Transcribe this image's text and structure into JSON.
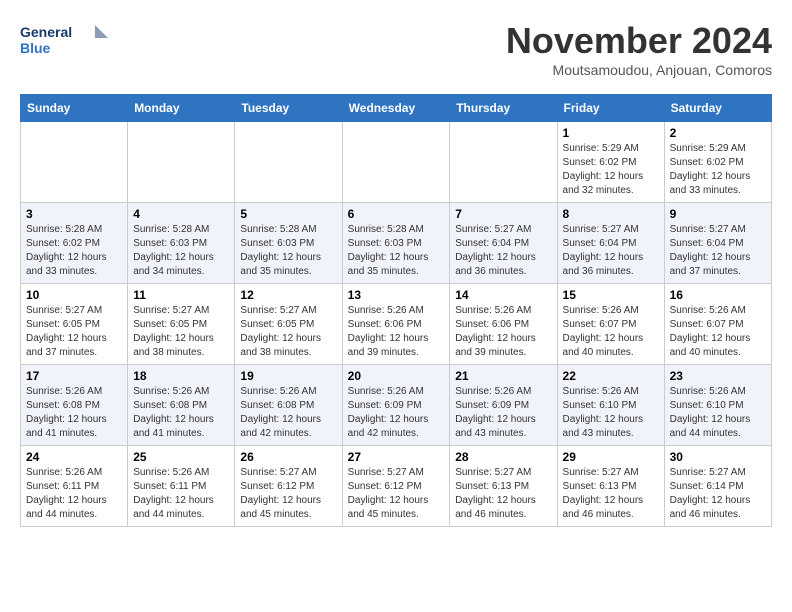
{
  "logo": {
    "line1": "General",
    "line2": "Blue"
  },
  "header": {
    "month_year": "November 2024",
    "location": "Moutsamoudou, Anjouan, Comoros"
  },
  "weekdays": [
    "Sunday",
    "Monday",
    "Tuesday",
    "Wednesday",
    "Thursday",
    "Friday",
    "Saturday"
  ],
  "weeks": [
    [
      {
        "day": "",
        "info": ""
      },
      {
        "day": "",
        "info": ""
      },
      {
        "day": "",
        "info": ""
      },
      {
        "day": "",
        "info": ""
      },
      {
        "day": "",
        "info": ""
      },
      {
        "day": "1",
        "info": "Sunrise: 5:29 AM\nSunset: 6:02 PM\nDaylight: 12 hours\nand 32 minutes."
      },
      {
        "day": "2",
        "info": "Sunrise: 5:29 AM\nSunset: 6:02 PM\nDaylight: 12 hours\nand 33 minutes."
      }
    ],
    [
      {
        "day": "3",
        "info": "Sunrise: 5:28 AM\nSunset: 6:02 PM\nDaylight: 12 hours\nand 33 minutes."
      },
      {
        "day": "4",
        "info": "Sunrise: 5:28 AM\nSunset: 6:03 PM\nDaylight: 12 hours\nand 34 minutes."
      },
      {
        "day": "5",
        "info": "Sunrise: 5:28 AM\nSunset: 6:03 PM\nDaylight: 12 hours\nand 35 minutes."
      },
      {
        "day": "6",
        "info": "Sunrise: 5:28 AM\nSunset: 6:03 PM\nDaylight: 12 hours\nand 35 minutes."
      },
      {
        "day": "7",
        "info": "Sunrise: 5:27 AM\nSunset: 6:04 PM\nDaylight: 12 hours\nand 36 minutes."
      },
      {
        "day": "8",
        "info": "Sunrise: 5:27 AM\nSunset: 6:04 PM\nDaylight: 12 hours\nand 36 minutes."
      },
      {
        "day": "9",
        "info": "Sunrise: 5:27 AM\nSunset: 6:04 PM\nDaylight: 12 hours\nand 37 minutes."
      }
    ],
    [
      {
        "day": "10",
        "info": "Sunrise: 5:27 AM\nSunset: 6:05 PM\nDaylight: 12 hours\nand 37 minutes."
      },
      {
        "day": "11",
        "info": "Sunrise: 5:27 AM\nSunset: 6:05 PM\nDaylight: 12 hours\nand 38 minutes."
      },
      {
        "day": "12",
        "info": "Sunrise: 5:27 AM\nSunset: 6:05 PM\nDaylight: 12 hours\nand 38 minutes."
      },
      {
        "day": "13",
        "info": "Sunrise: 5:26 AM\nSunset: 6:06 PM\nDaylight: 12 hours\nand 39 minutes."
      },
      {
        "day": "14",
        "info": "Sunrise: 5:26 AM\nSunset: 6:06 PM\nDaylight: 12 hours\nand 39 minutes."
      },
      {
        "day": "15",
        "info": "Sunrise: 5:26 AM\nSunset: 6:07 PM\nDaylight: 12 hours\nand 40 minutes."
      },
      {
        "day": "16",
        "info": "Sunrise: 5:26 AM\nSunset: 6:07 PM\nDaylight: 12 hours\nand 40 minutes."
      }
    ],
    [
      {
        "day": "17",
        "info": "Sunrise: 5:26 AM\nSunset: 6:08 PM\nDaylight: 12 hours\nand 41 minutes."
      },
      {
        "day": "18",
        "info": "Sunrise: 5:26 AM\nSunset: 6:08 PM\nDaylight: 12 hours\nand 41 minutes."
      },
      {
        "day": "19",
        "info": "Sunrise: 5:26 AM\nSunset: 6:08 PM\nDaylight: 12 hours\nand 42 minutes."
      },
      {
        "day": "20",
        "info": "Sunrise: 5:26 AM\nSunset: 6:09 PM\nDaylight: 12 hours\nand 42 minutes."
      },
      {
        "day": "21",
        "info": "Sunrise: 5:26 AM\nSunset: 6:09 PM\nDaylight: 12 hours\nand 43 minutes."
      },
      {
        "day": "22",
        "info": "Sunrise: 5:26 AM\nSunset: 6:10 PM\nDaylight: 12 hours\nand 43 minutes."
      },
      {
        "day": "23",
        "info": "Sunrise: 5:26 AM\nSunset: 6:10 PM\nDaylight: 12 hours\nand 44 minutes."
      }
    ],
    [
      {
        "day": "24",
        "info": "Sunrise: 5:26 AM\nSunset: 6:11 PM\nDaylight: 12 hours\nand 44 minutes."
      },
      {
        "day": "25",
        "info": "Sunrise: 5:26 AM\nSunset: 6:11 PM\nDaylight: 12 hours\nand 44 minutes."
      },
      {
        "day": "26",
        "info": "Sunrise: 5:27 AM\nSunset: 6:12 PM\nDaylight: 12 hours\nand 45 minutes."
      },
      {
        "day": "27",
        "info": "Sunrise: 5:27 AM\nSunset: 6:12 PM\nDaylight: 12 hours\nand 45 minutes."
      },
      {
        "day": "28",
        "info": "Sunrise: 5:27 AM\nSunset: 6:13 PM\nDaylight: 12 hours\nand 46 minutes."
      },
      {
        "day": "29",
        "info": "Sunrise: 5:27 AM\nSunset: 6:13 PM\nDaylight: 12 hours\nand 46 minutes."
      },
      {
        "day": "30",
        "info": "Sunrise: 5:27 AM\nSunset: 6:14 PM\nDaylight: 12 hours\nand 46 minutes."
      }
    ]
  ]
}
